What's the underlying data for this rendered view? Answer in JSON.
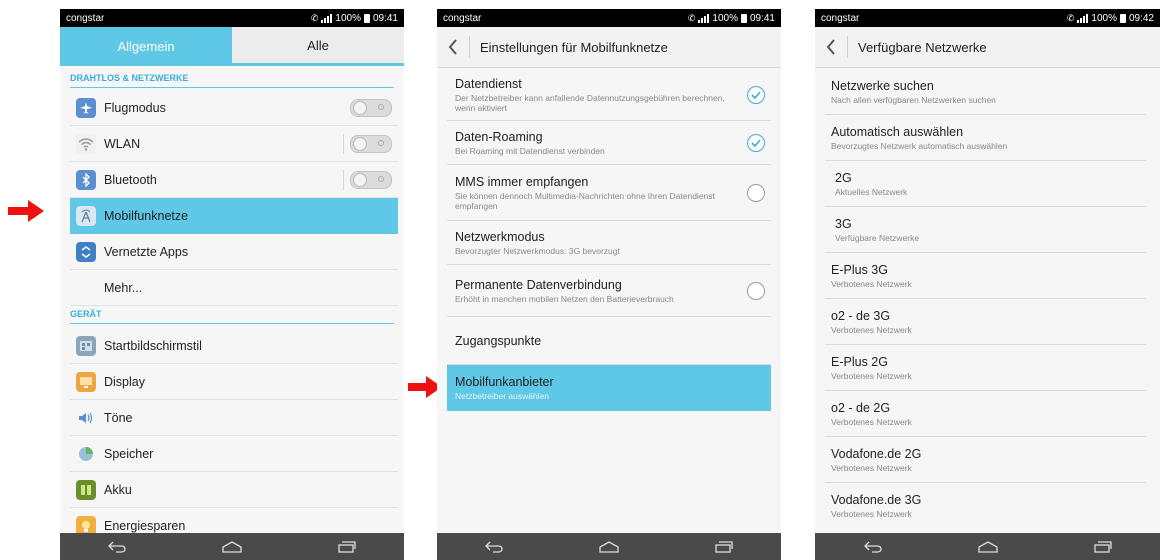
{
  "status": {
    "carrier": "congstar",
    "battery": "100%",
    "time1": "09:41",
    "time2": "09:41",
    "time3": "09:42"
  },
  "screen1": {
    "tabs": [
      {
        "label": "Allgemein",
        "active": true
      },
      {
        "label": "Alle",
        "active": false
      }
    ],
    "section_wireless": "DRAHTLOS & NETZWERKE",
    "section_device": "GERÄT",
    "items": [
      {
        "label": "Flugmodus",
        "icon": "airplane-icon",
        "toggle": true
      },
      {
        "label": "WLAN",
        "icon": "wifi-icon",
        "toggle": true
      },
      {
        "label": "Bluetooth",
        "icon": "bluetooth-icon",
        "toggle": true
      },
      {
        "label": "Mobilfunknetze",
        "icon": "mobile-network-icon",
        "selected": true
      },
      {
        "label": "Vernetzte Apps",
        "icon": "connected-apps-icon"
      },
      {
        "label": "Mehr...",
        "icon": ""
      },
      {
        "label": "Startbildschirmstil",
        "icon": "homescreen-icon"
      },
      {
        "label": "Display",
        "icon": "display-icon"
      },
      {
        "label": "Töne",
        "icon": "speaker-icon"
      },
      {
        "label": "Speicher",
        "icon": "storage-icon"
      },
      {
        "label": "Akku",
        "icon": "battery-icon"
      },
      {
        "label": "Energiesparen",
        "icon": "energy-saving-icon"
      }
    ]
  },
  "screen2": {
    "title": "Einstellungen für Mobilfunknetze",
    "items": [
      {
        "title": "Datendienst",
        "sub": "Der Netzbetreiber kann anfallende Datennutzungsgebühren berechnen, wenn aktiviert",
        "checkbox": "on"
      },
      {
        "title": "Daten-Roaming",
        "sub": "Bei Roaming mit Datendienst verbinden",
        "checkbox": "on"
      },
      {
        "title": "MMS immer empfangen",
        "sub": "Sie können dennoch Multimedia-Nachrichten ohne Ihren Datendienst empfangen",
        "checkbox": "off"
      },
      {
        "title": "Netzwerkmodus",
        "sub": "Bevorzugter Netzwerkmodus: 3G bevorzugt"
      },
      {
        "title": "Permanente Datenverbindung",
        "sub": "Erhöht in manchen mobilen Netzen den Batterieverbrauch",
        "checkbox": "off"
      },
      {
        "title": "Zugangspunkte",
        "sub": ""
      },
      {
        "title": "Mobilfunkanbieter",
        "sub": "Netzbetreiber auswählen",
        "selected": true
      }
    ]
  },
  "screen3": {
    "title": "Verfügbare Netzwerke",
    "items": [
      {
        "title": "Netzwerke suchen",
        "sub": "Nach allen verfügbaren Netzwerken suchen"
      },
      {
        "title": "Automatisch auswählen",
        "sub": "Bevorzugtes Netzwerk automatisch auswählen"
      },
      {
        "title": "2G",
        "sub": "Aktuelles Netzwerk"
      },
      {
        "title": "3G",
        "sub": "Verfügbare Netzwerke"
      },
      {
        "title": "E-Plus 3G",
        "sub": "Verbotenes Netzwerk"
      },
      {
        "title": "o2 - de 3G",
        "sub": "Verbotenes Netzwerk"
      },
      {
        "title": "E-Plus 2G",
        "sub": "Verbotenes Netzwerk"
      },
      {
        "title": "o2 - de 2G",
        "sub": "Verbotenes Netzwerk"
      },
      {
        "title": "Vodafone.de 2G",
        "sub": "Verbotenes Netzwerk"
      },
      {
        "title": "Vodafone.de 3G",
        "sub": "Verbotenes Netzwerk"
      }
    ]
  },
  "colors": {
    "accent": "#5ec8e6",
    "accent_text": "#3aaed8",
    "arrow": "#ee1111",
    "navbar": "#4a4a4a"
  }
}
